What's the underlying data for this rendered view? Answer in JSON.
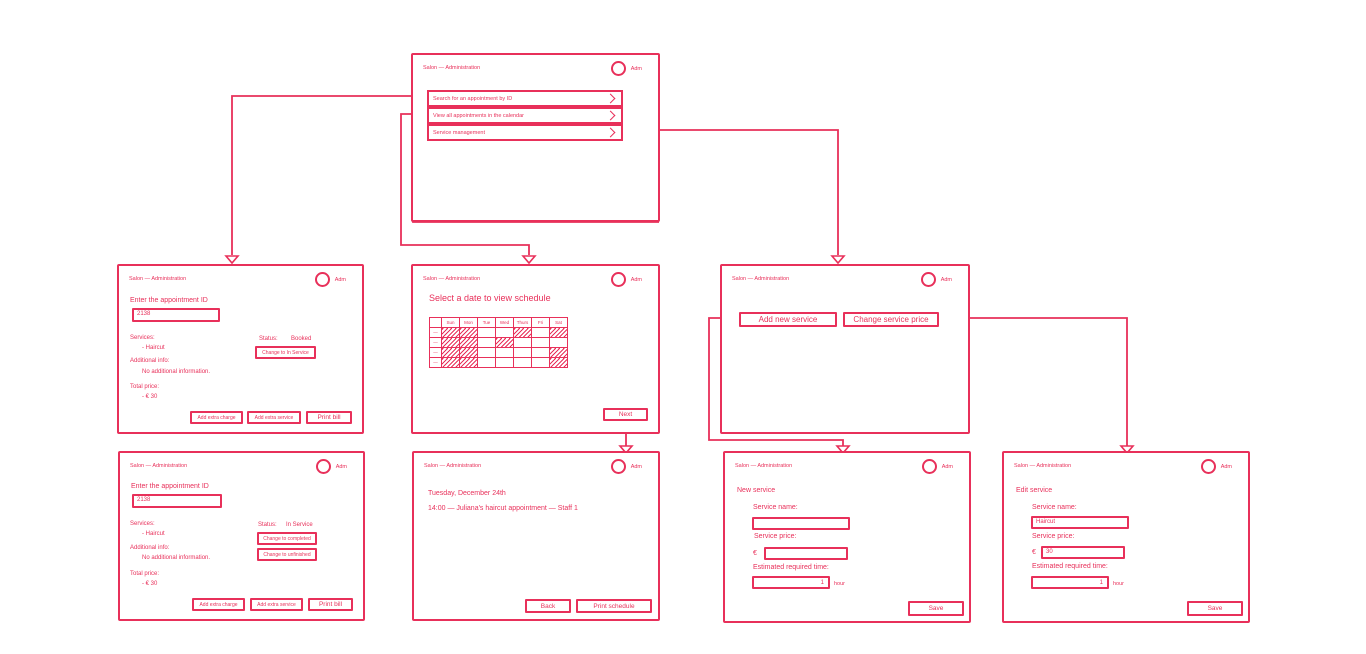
{
  "colors": {
    "stroke": "#e8305a",
    "background": "#ffffff"
  },
  "common": {
    "title": "Salon — Administration",
    "user": "Adm"
  },
  "home": {
    "menu": [
      "Search for an appointment by ID",
      "View all appointments in the calendar",
      "Service management"
    ]
  },
  "search1": {
    "id_label": "Enter the appointment ID",
    "id_value": "2138",
    "services_label": "Services:",
    "service_item": "- Haircut",
    "status_label": "Status:",
    "status_value": "Booked",
    "change_button": "Change to In Service",
    "info_label": "Additional info:",
    "info_value": "No additional information.",
    "total_label": "Total price:",
    "total_value": "- € 30",
    "buttons": [
      "Add extra charge",
      "Add extra service",
      "Print bill"
    ]
  },
  "search2": {
    "id_label": "Enter the appointment ID",
    "id_value": "2138",
    "services_label": "Services:",
    "service_item": "- Haircut",
    "status_label": "Status:",
    "status_value": "In Service",
    "change_completed": "Change to completed",
    "change_unfinished": "Change to unfinished",
    "info_label": "Additional info:",
    "info_value": "No additional information.",
    "total_label": "Total price:",
    "total_value": "- € 30",
    "buttons": [
      "Add extra charge",
      "Add extra service",
      "Print bill"
    ]
  },
  "calendar": {
    "heading": "Select a date to view schedule",
    "days": [
      "Sun",
      "Mon",
      "Tue",
      "Wed",
      "Thurs",
      "Fri",
      "Sat"
    ],
    "row_labels": [
      "—",
      "—",
      "—",
      "—"
    ],
    "hatched": [
      [
        1,
        1,
        0,
        0,
        1,
        0,
        1
      ],
      [
        1,
        1,
        0,
        1,
        0,
        0,
        0
      ],
      [
        1,
        1,
        0,
        0,
        0,
        0,
        1
      ],
      [
        1,
        1,
        0,
        0,
        0,
        0,
        1
      ]
    ],
    "next_button": "Next"
  },
  "schedule": {
    "date": "Tuesday, December 24th",
    "entry": "14:00 — Juliana's haircut appointment — Staff 1",
    "back_button": "Back",
    "print_button": "Print schedule"
  },
  "service_mgmt": {
    "add_button": "Add new service",
    "change_button": "Change service price"
  },
  "new_service": {
    "heading": "New service",
    "name_label": "Service name:",
    "name_value": "",
    "price_label": "Service price:",
    "currency": "€",
    "price_value": "",
    "time_label": "Estimated required time:",
    "time_value": "1",
    "time_unit": "hour",
    "save_button": "Save"
  },
  "edit_service": {
    "heading": "Edit service",
    "name_label": "Service name:",
    "name_value": "Haircut",
    "price_label": "Service price:",
    "currency": "€",
    "price_value": "30",
    "time_label": "Estimated required time:",
    "time_value": "1",
    "time_unit": "hour",
    "save_button": "Save"
  }
}
